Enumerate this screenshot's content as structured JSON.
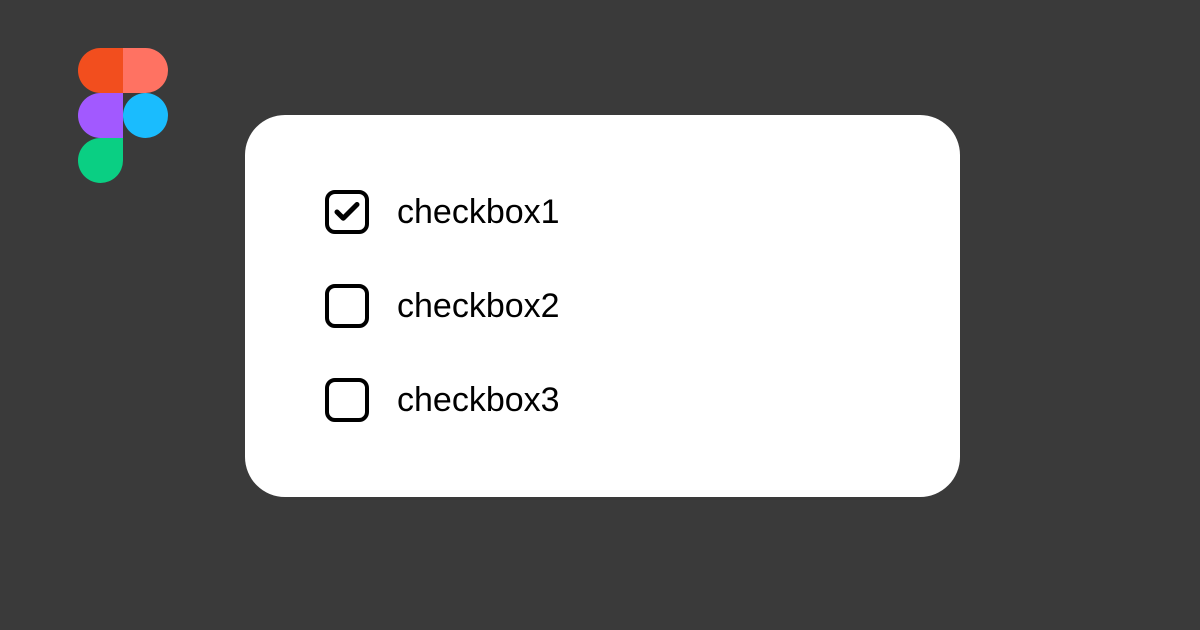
{
  "checkboxes": [
    {
      "label": "checkbox1",
      "checked": true
    },
    {
      "label": "checkbox2",
      "checked": false
    },
    {
      "label": "checkbox3",
      "checked": false
    }
  ]
}
